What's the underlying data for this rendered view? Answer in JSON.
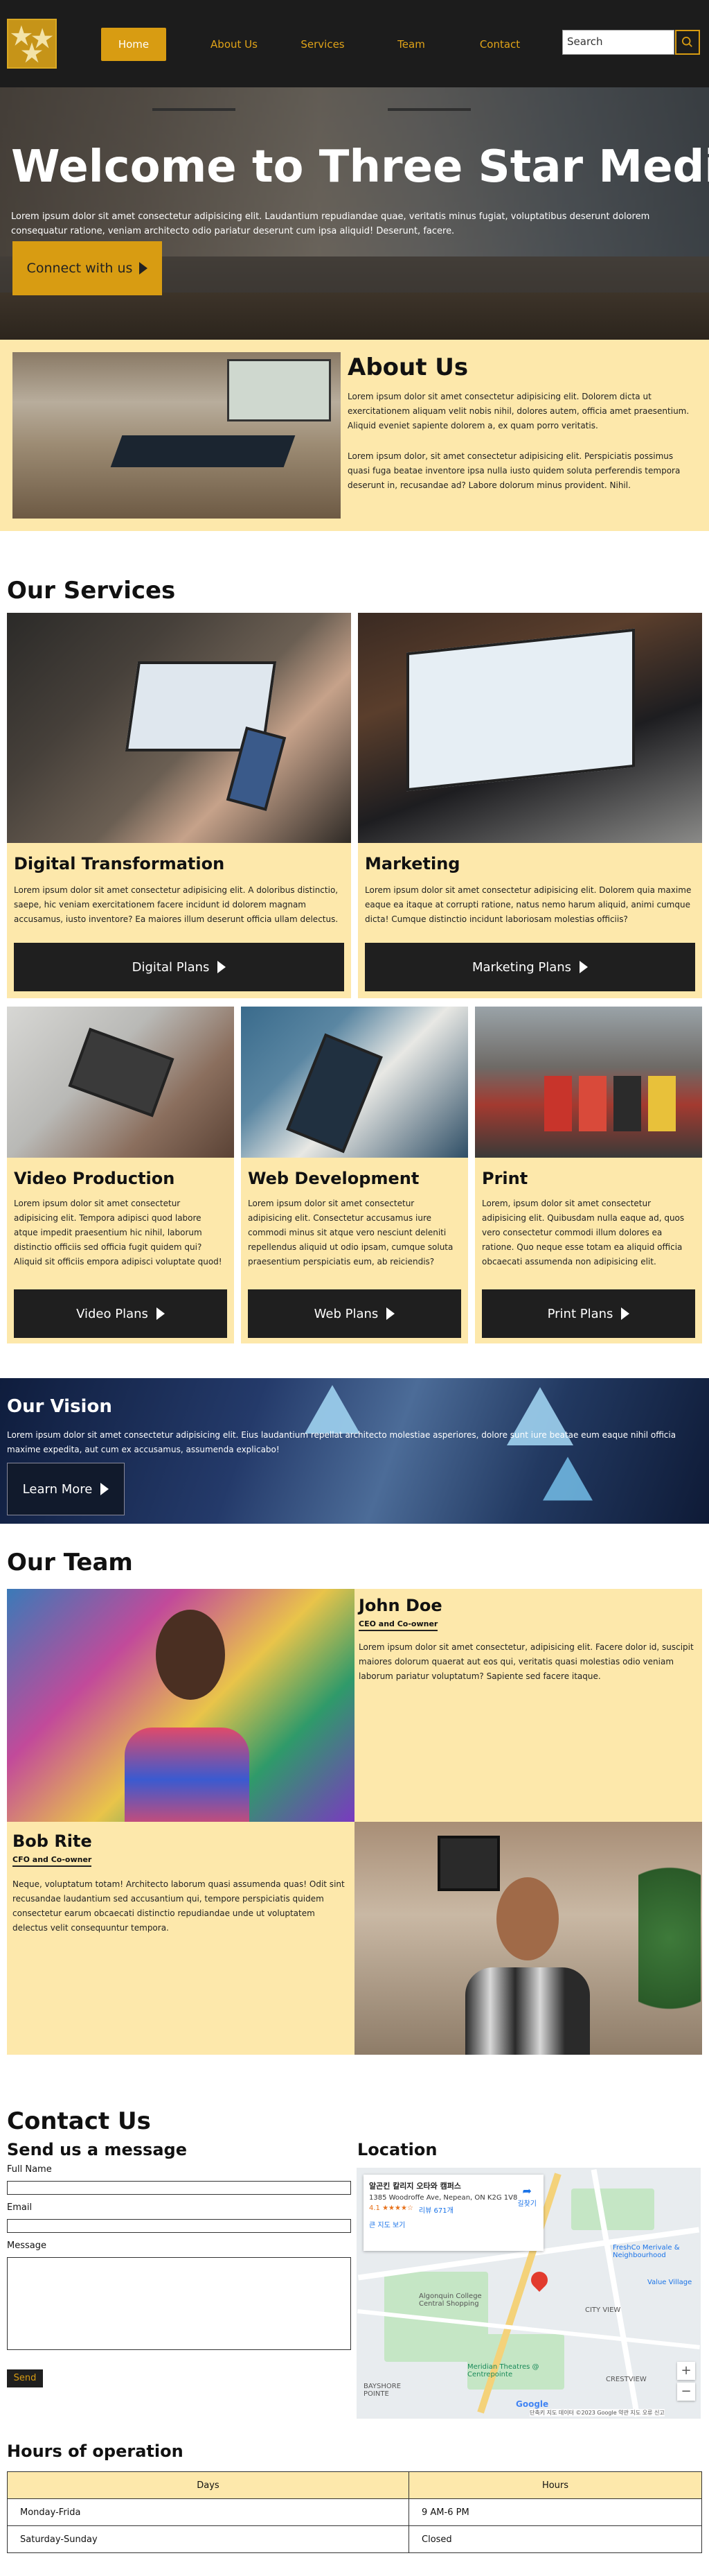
{
  "nav": {
    "logo_icon": "three-stars-logo",
    "links": [
      {
        "label": "Home"
      },
      {
        "label": "About Us"
      },
      {
        "label": "Services"
      },
      {
        "label": "Team"
      },
      {
        "label": "Contact"
      }
    ],
    "search_placeholder": "Search",
    "search_icon": "search-icon",
    "accent": "#d89c12"
  },
  "hero": {
    "title": "Welcome to Three Star Media",
    "text": "Lorem ipsum dolor sit amet consectetur adipisicing elit. Laudantium repudiandae quae, veritatis minus fugiat, voluptatibus deserunt dolorem consequatur ratione, veniam architecto odio pariatur deserunt cum ipsa aliquid! Deserunt, facere.",
    "button_label": "Connect with us"
  },
  "about": {
    "title": "About Us",
    "p1": "Lorem ipsum dolor sit amet consectetur adipisicing elit. Dolorem dicta ut exercitationem aliquam velit nobis nihil, dolores autem, officia amet praesentium. Aliquid eveniet sapiente dolorem a, ex quam porro veritatis.",
    "p2": "Lorem ipsum dolor, sit amet consectetur adipisicing elit. Perspiciatis possimus quasi fuga beatae inventore ipsa nulla iusto quidem soluta perferendis tempora deserunt in, recusandae ad? Labore dolorum minus provident. Nihil."
  },
  "services": {
    "title": "Our Services",
    "cards": [
      {
        "title": "Digital Transformation",
        "text": "Lorem ipsum dolor sit amet consectetur adipisicing elit. A doloribus distinctio, saepe, hic veniam exercitationem facere incidunt id dolorem magnam accusamus, iusto inventore? Ea maiores illum deserunt officia ullam delectus.",
        "button": "Digital Plans"
      },
      {
        "title": "Marketing",
        "text": "Lorem ipsum dolor sit amet consectetur adipisicing elit. Dolorem quia maxime eaque ea itaque at corrupti ratione, natus nemo harum aliquid, animi cumque dicta! Cumque distinctio incidunt laboriosam molestias officiis?",
        "button": "Marketing Plans"
      },
      {
        "title": "Video Production",
        "text": "Lorem ipsum dolor sit amet consectetur adipisicing elit. Tempora adipisci quod labore atque impedit praesentium hic nihil, laborum distinctio officiis sed officia fugit quidem qui? Aliquid sit officiis empora adipisci voluptate quod!",
        "button": "Video Plans"
      },
      {
        "title": "Web Development",
        "text": "Lorem ipsum dolor sit amet consectetur adipisicing elit. Consectetur accusamus iure commodi minus sit atque vero nesciunt deleniti repellendus aliquid ut odio ipsam, cumque soluta praesentium perspiciatis eum, ab reiciendis?",
        "button": "Web Plans"
      },
      {
        "title": "Print",
        "text": "Lorem, ipsum dolor sit amet consectetur adipisicing elit. Quibusdam nulla eaque ad, quos vero consectetur commodi illum dolores ea ratione. Quo neque esse totam ea aliquid officia obcaecati assumenda non adipisicing elit.",
        "button": "Print Plans"
      }
    ]
  },
  "vision": {
    "title": "Our Vision",
    "text": "Lorem ipsum dolor sit amet consectetur adipisicing elit. Eius laudantium repellat architecto molestiae asperiores, dolore sunt iure beatae eum eaque nihil officia maxime expedita, aut cum ex accusamus, assumenda explicabo!",
    "button": "Learn More"
  },
  "team": {
    "title": "Our Team",
    "members": [
      {
        "name": "John Doe",
        "role": "CEO and Co-owner",
        "text": "Lorem ipsum dolor sit amet consectetur, adipisicing elit. Facere dolor id, suscipit maiores dolorum quaerat aut eos qui, veritatis quasi molestias odio veniam laborum pariatur voluptatum? Sapiente sed facere itaque."
      },
      {
        "name": "Bob Rite",
        "role": "CFO and Co-owner",
        "text": "Neque, voluptatum totam! Architecto laborum quasi assumenda quas! Odit sint recusandae laudantium sed accusantium qui, tempore perspiciatis quidem consectetur earum obcaecati distinctio repudiandae unde ut voluptatem delectus velit consequuntur tempora."
      }
    ]
  },
  "contact": {
    "title": "Contact Us",
    "form_title": "Send us a message",
    "full_name_label": "Full Name",
    "email_label": "Email",
    "message_label": "Message",
    "send_button": "Send",
    "location_title": "Location",
    "map": {
      "place_name": "알곤킨 칼리지 오타와 캠퍼스",
      "address": "1385 Woodroffe Ave, Nepean, ON K2G 1V8",
      "rating": "4.1 ★★★★☆",
      "reviews": "리뷰 671개",
      "larger_map": "큰 지도 보기",
      "directions": "길찾기",
      "label_college": "Algonquin College Central Shopping",
      "label_centre": "Meridian Theatres @ Centrepointe",
      "label_crestview": "CRESTVIEW",
      "label_city_view": "CITY VIEW",
      "label_freshco": "FreshCo Merivale & Neighbourhood",
      "label_valu": "Value Village",
      "label_bayshore": "BAYSHORE POINTE",
      "google": "Google",
      "map_footer": "단축키  지도 데이터 ©2023 Google  약관  지도 오류 신고"
    }
  },
  "hours": {
    "title": "Hours of operation",
    "headers": [
      "Days",
      "Hours"
    ],
    "rows": [
      [
        "Monday-Frida",
        "9 AM-6 PM"
      ],
      [
        "Saturday-Sunday",
        "Closed"
      ]
    ]
  }
}
